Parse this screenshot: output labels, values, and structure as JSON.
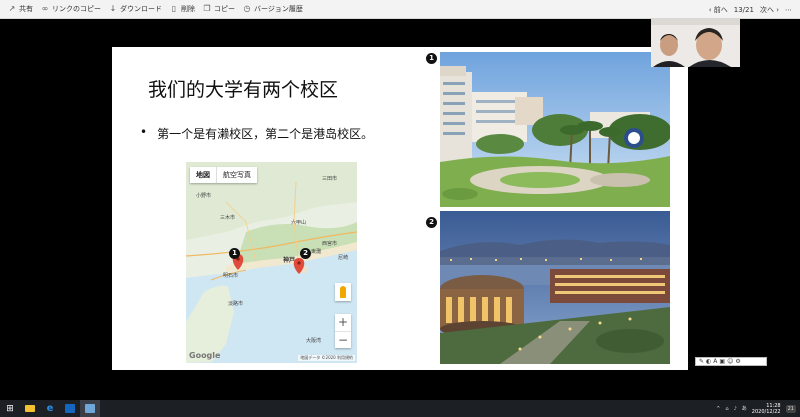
{
  "toolbar": {
    "share_label": "共有",
    "copy_link_label": "リンクのコピー",
    "download_label": "ダウンロード",
    "delete_label": "削除",
    "copy_label": "コピー",
    "version_history_label": "バージョン履歴",
    "prev_label": "前へ",
    "page_counter": "13/21",
    "next_label": "次へ"
  },
  "slide": {
    "title": "我们的大学有两个校区",
    "bullet_marker": "•",
    "bullet_text": "第一个是有濑校区，第二个是港岛校区。",
    "badge1": "1",
    "badge2": "2"
  },
  "map": {
    "tab_map": "地図",
    "tab_satellite": "航空写真",
    "marker1": "1",
    "marker2": "2",
    "zoom_in": "+",
    "zoom_out": "−",
    "google_logo": "Google",
    "attribution": "地図データ ©2020  利用規約",
    "labels": [
      "小野市",
      "三田市",
      "三木市",
      "六甲山",
      "神戸",
      "明石市",
      "西宮市",
      "淡路市",
      "大阪湾",
      "尼崎",
      "東灘"
    ]
  },
  "taskbar": {
    "time": "11:28",
    "date": "2020/12/22",
    "ime": "あ",
    "notifications": "21"
  },
  "colors": {
    "toolbar_bg": "#f3f3f3",
    "taskbar_bg": "#1c1f24",
    "map_marker": "#e04a3a",
    "slide_bg": "#ffffff"
  },
  "icons": {
    "share": "share-icon",
    "link": "link-icon",
    "download": "download-icon",
    "delete": "trash-icon",
    "copy": "copy-icon",
    "history": "history-icon",
    "prev": "arrow-up-icon",
    "next": "arrow-down-icon",
    "more": "more-icon"
  }
}
